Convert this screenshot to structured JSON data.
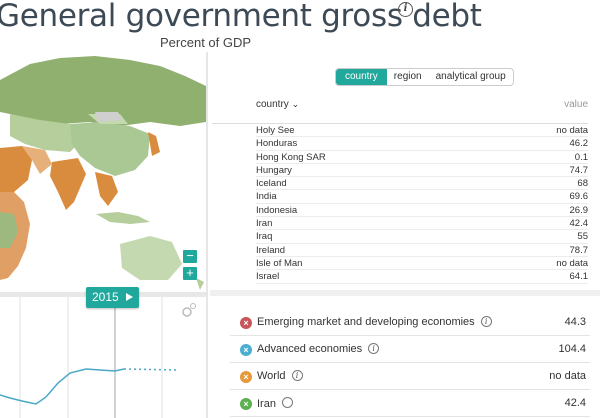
{
  "header": {
    "title": "General government gross debt",
    "subtitle": "Percent of GDP"
  },
  "map": {
    "zoom_out": "−",
    "zoom_in": "+"
  },
  "view_toggle": {
    "options": [
      "country",
      "region",
      "analytical group"
    ],
    "selected": "country"
  },
  "table": {
    "column_country": "country",
    "column_value": "value",
    "rows": [
      {
        "name": "Holy See",
        "value": "no data"
      },
      {
        "name": "Honduras",
        "value": "46.2"
      },
      {
        "name": "Hong Kong SAR",
        "value": "0.1"
      },
      {
        "name": "Hungary",
        "value": "74.7"
      },
      {
        "name": "Iceland",
        "value": "68"
      },
      {
        "name": "India",
        "value": "69.6"
      },
      {
        "name": "Indonesia",
        "value": "26.9"
      },
      {
        "name": "Iran",
        "value": "42.4"
      },
      {
        "name": "Iraq",
        "value": "55"
      },
      {
        "name": "Ireland",
        "value": "78.7"
      },
      {
        "name": "Isle of Man",
        "value": "no data"
      },
      {
        "name": "Israel",
        "value": "64.1"
      }
    ]
  },
  "timeline": {
    "year": "2015"
  },
  "comparison": [
    {
      "name": "Emerging market and developing economies",
      "value": "44.3",
      "color": "#c9555a"
    },
    {
      "name": "Advanced economies",
      "value": "104.4",
      "color": "#4aaed0"
    },
    {
      "name": "World",
      "value": "no data",
      "color": "#e59a3c"
    },
    {
      "name": "Iran",
      "value": "42.4",
      "color": "#5bb04f"
    }
  ],
  "colors": {
    "accent": "#20a89c",
    "map_green_dark": "#7fa865",
    "map_green_light": "#c4d9b0",
    "map_orange": "#d98b3e",
    "map_nodata": "#cfcfcf",
    "line": "#4aa7c6"
  }
}
